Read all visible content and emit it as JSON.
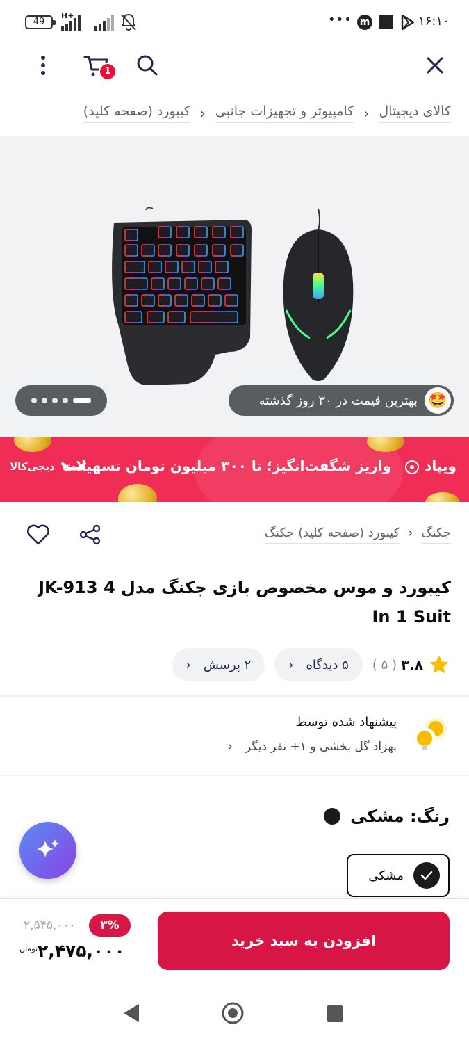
{
  "status_bar": {
    "battery": "49",
    "network": "H+",
    "time": "۱۶:۱۰",
    "more": "•••",
    "app_m": "m"
  },
  "topbar": {
    "cart_count": "1"
  },
  "breadcrumb": [
    "کالای دیجیتال",
    "کامپیوتر و تجهیزات جانبی",
    "کیبورد (صفحه کلید)"
  ],
  "gallery": {
    "best_price": "بهترین قیمت در ۳۰ روز گذشته",
    "best_price_emoji": "🤩",
    "dot_count": 5,
    "active_dot": 0
  },
  "banner": {
    "brand_right": "ویپاد",
    "text": "واریز شگفت‌انگیز؛ تا ۳۰۰ میلیون تومان تسهیلات",
    "brand_left": "دیجی‌کالا"
  },
  "product": {
    "category_crumbs": [
      "جکنگ",
      "کیبورد (صفحه کلید) جکنگ"
    ],
    "title": "کیبورد و موس مخصوص بازی جکنگ مدل JK-913 4 In 1 Suit",
    "rating": "۳.۸",
    "rating_count": "( ۵ )",
    "reviews": "۵ دیدگاه",
    "questions": "۲ پرسش"
  },
  "suggestion": {
    "title": "پیشنهاد شده توسط",
    "by": "بهزاد گل بخشی و ۱+ نفر دیگر"
  },
  "color": {
    "label": "رنگ: مشکی",
    "selected_chip": "مشکی",
    "swatch": "#1a1a1a"
  },
  "purchase": {
    "add_to_cart": "افزودن به سبد خرید",
    "discount": "۳%",
    "old_price": "۲,۵۴۵,۰۰۰",
    "price": "۲,۴۷۵,۰۰۰",
    "currency": "تومان"
  },
  "colors": {
    "primary": "#d81645",
    "banner": "#ef2d55",
    "text": "#0c0c0c"
  }
}
